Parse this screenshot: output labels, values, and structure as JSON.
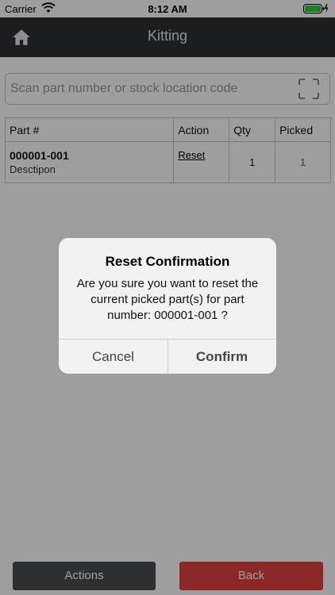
{
  "status_bar": {
    "carrier": "Carrier",
    "time": "8:12 AM"
  },
  "nav": {
    "title": "Kitting",
    "home_icon": "home-icon"
  },
  "search": {
    "placeholder": "Scan part number or stock location code",
    "value": "",
    "scan_icon": "scan-frame-icon"
  },
  "table": {
    "headers": {
      "part": "Part #",
      "action": "Action",
      "qty": "Qty",
      "picked": "Picked"
    },
    "rows": [
      {
        "part": "000001-001",
        "desc": "Desctipon",
        "action": "Reset",
        "qty": "1",
        "picked": "1"
      }
    ]
  },
  "buttons": {
    "actions": "Actions",
    "back": "Back"
  },
  "dialog": {
    "title": "Reset Confirmation",
    "message": "Are you sure you want to reset the current picked part(s) for part number: 000001-001 ?",
    "cancel": "Cancel",
    "confirm": "Confirm"
  },
  "colors": {
    "nav_bg": "#2e2f31",
    "back_button": "#e04040",
    "actions_button": "#4a4c4e",
    "picked_value": "#1a8c1a"
  }
}
